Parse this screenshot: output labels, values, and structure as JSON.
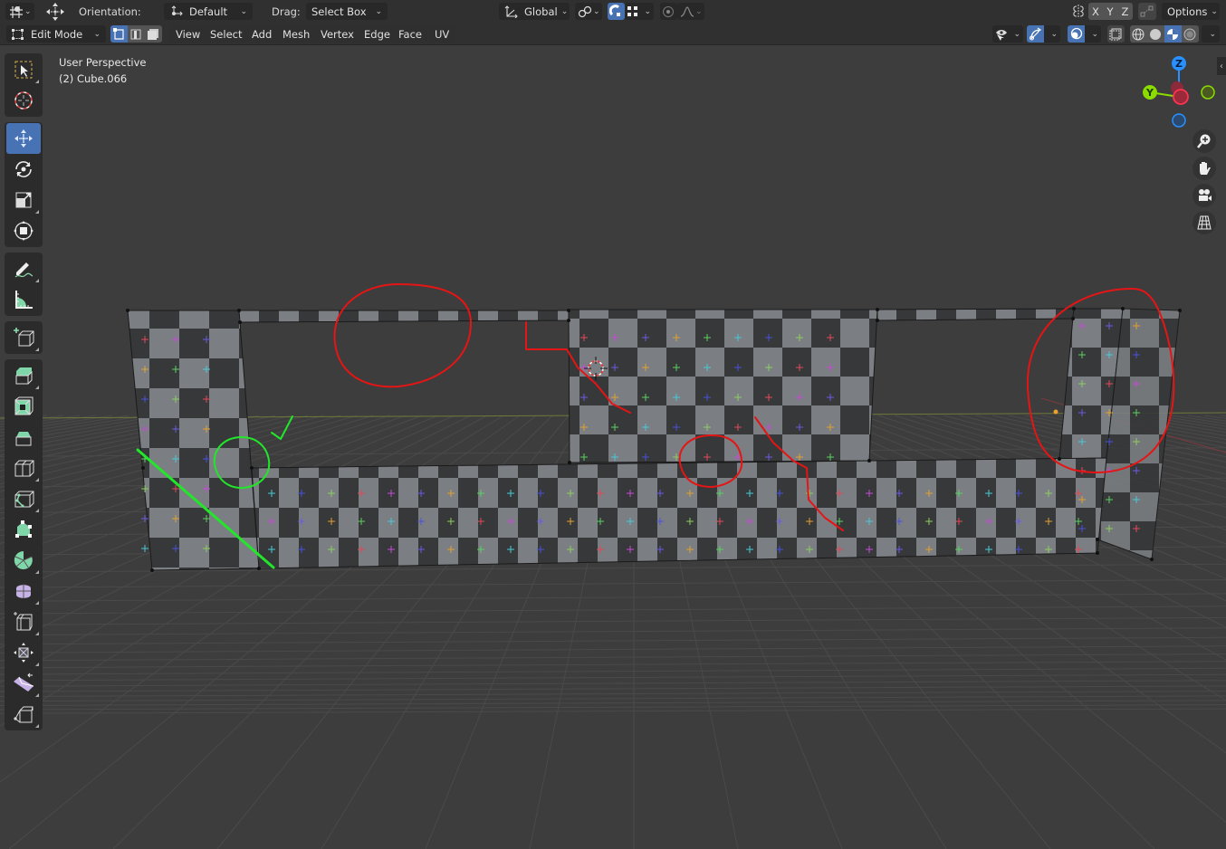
{
  "header_top": {
    "editor_type_icon": "viewport-editor-icon",
    "transform_icon": "move-transform-icon",
    "orientation_label": "Orientation:",
    "orientation_value": "Default",
    "drag_label": "Drag:",
    "drag_value": "Select Box",
    "transform_space_value": "Global",
    "pivot_icon": "pivot-link-icon",
    "snap_icon": "snap-magnet-icon",
    "snap_target_icon": "snap-grid-icon",
    "proportional_icon": "proportional-edit-icon",
    "falloff_icon": "falloff-curve-icon",
    "mirror_icon": "mirror-icon",
    "mirror_axes": [
      "X",
      "Y",
      "Z"
    ],
    "autoscale_icon": "auto-merge-icon",
    "options_label": "Options"
  },
  "header_menu": {
    "mode_value": "Edit Mode",
    "select_modes": [
      "vertex",
      "edge",
      "face"
    ],
    "active_select_mode": "vertex",
    "menus": [
      "View",
      "Select",
      "Add",
      "Mesh",
      "Vertex",
      "Edge",
      "Face",
      "UV"
    ],
    "right_icons": [
      "visibility-icon",
      "gizmo-icon",
      "overlay-icon",
      "xray-icon",
      "shading-wireframe-icon",
      "shading-solid-icon",
      "shading-material-icon",
      "shading-rendered-icon"
    ],
    "active_shading": "material"
  },
  "viewport": {
    "view_name": "User Perspective",
    "object_name": "(2) Cube.066"
  },
  "toolbar": {
    "tools": [
      {
        "name": "select-box",
        "active": false
      },
      {
        "name": "cursor",
        "active": false
      },
      {
        "name": "move",
        "active": true
      },
      {
        "name": "rotate",
        "active": false
      },
      {
        "name": "scale",
        "active": false
      },
      {
        "name": "transform",
        "active": false
      },
      {
        "name": "annotate",
        "active": false
      },
      {
        "name": "measure",
        "active": false
      },
      {
        "name": "add-cube",
        "active": false
      },
      {
        "name": "extrude-region",
        "active": false
      },
      {
        "name": "inset-faces",
        "active": false
      },
      {
        "name": "bevel",
        "active": false
      },
      {
        "name": "loop-cut",
        "active": false
      },
      {
        "name": "knife",
        "active": false
      },
      {
        "name": "poly-build",
        "active": false
      },
      {
        "name": "spin",
        "active": false
      },
      {
        "name": "smooth",
        "active": false
      },
      {
        "name": "edge-slide",
        "active": false
      },
      {
        "name": "shrink-fatten",
        "active": false
      },
      {
        "name": "shear",
        "active": false
      },
      {
        "name": "rip-region",
        "active": false
      }
    ]
  },
  "gizmo": {
    "axes": {
      "z": "Z",
      "y": "Y",
      "x": "X"
    },
    "colors": {
      "x": "#ff3352",
      "y": "#8bdc00",
      "z": "#2890ff"
    },
    "nav_buttons": [
      "zoom-icon",
      "pan-hand-icon",
      "camera-icon",
      "ortho-grid-icon"
    ]
  },
  "colors": {
    "header_bg": "#303030",
    "viewport_bg": "#3d3d3d",
    "accent_blue": "#4772b3",
    "annotation_red": "#e51515",
    "annotation_green": "#22e62a",
    "checker_light": "#7d8185",
    "checker_dark": "#363738"
  }
}
